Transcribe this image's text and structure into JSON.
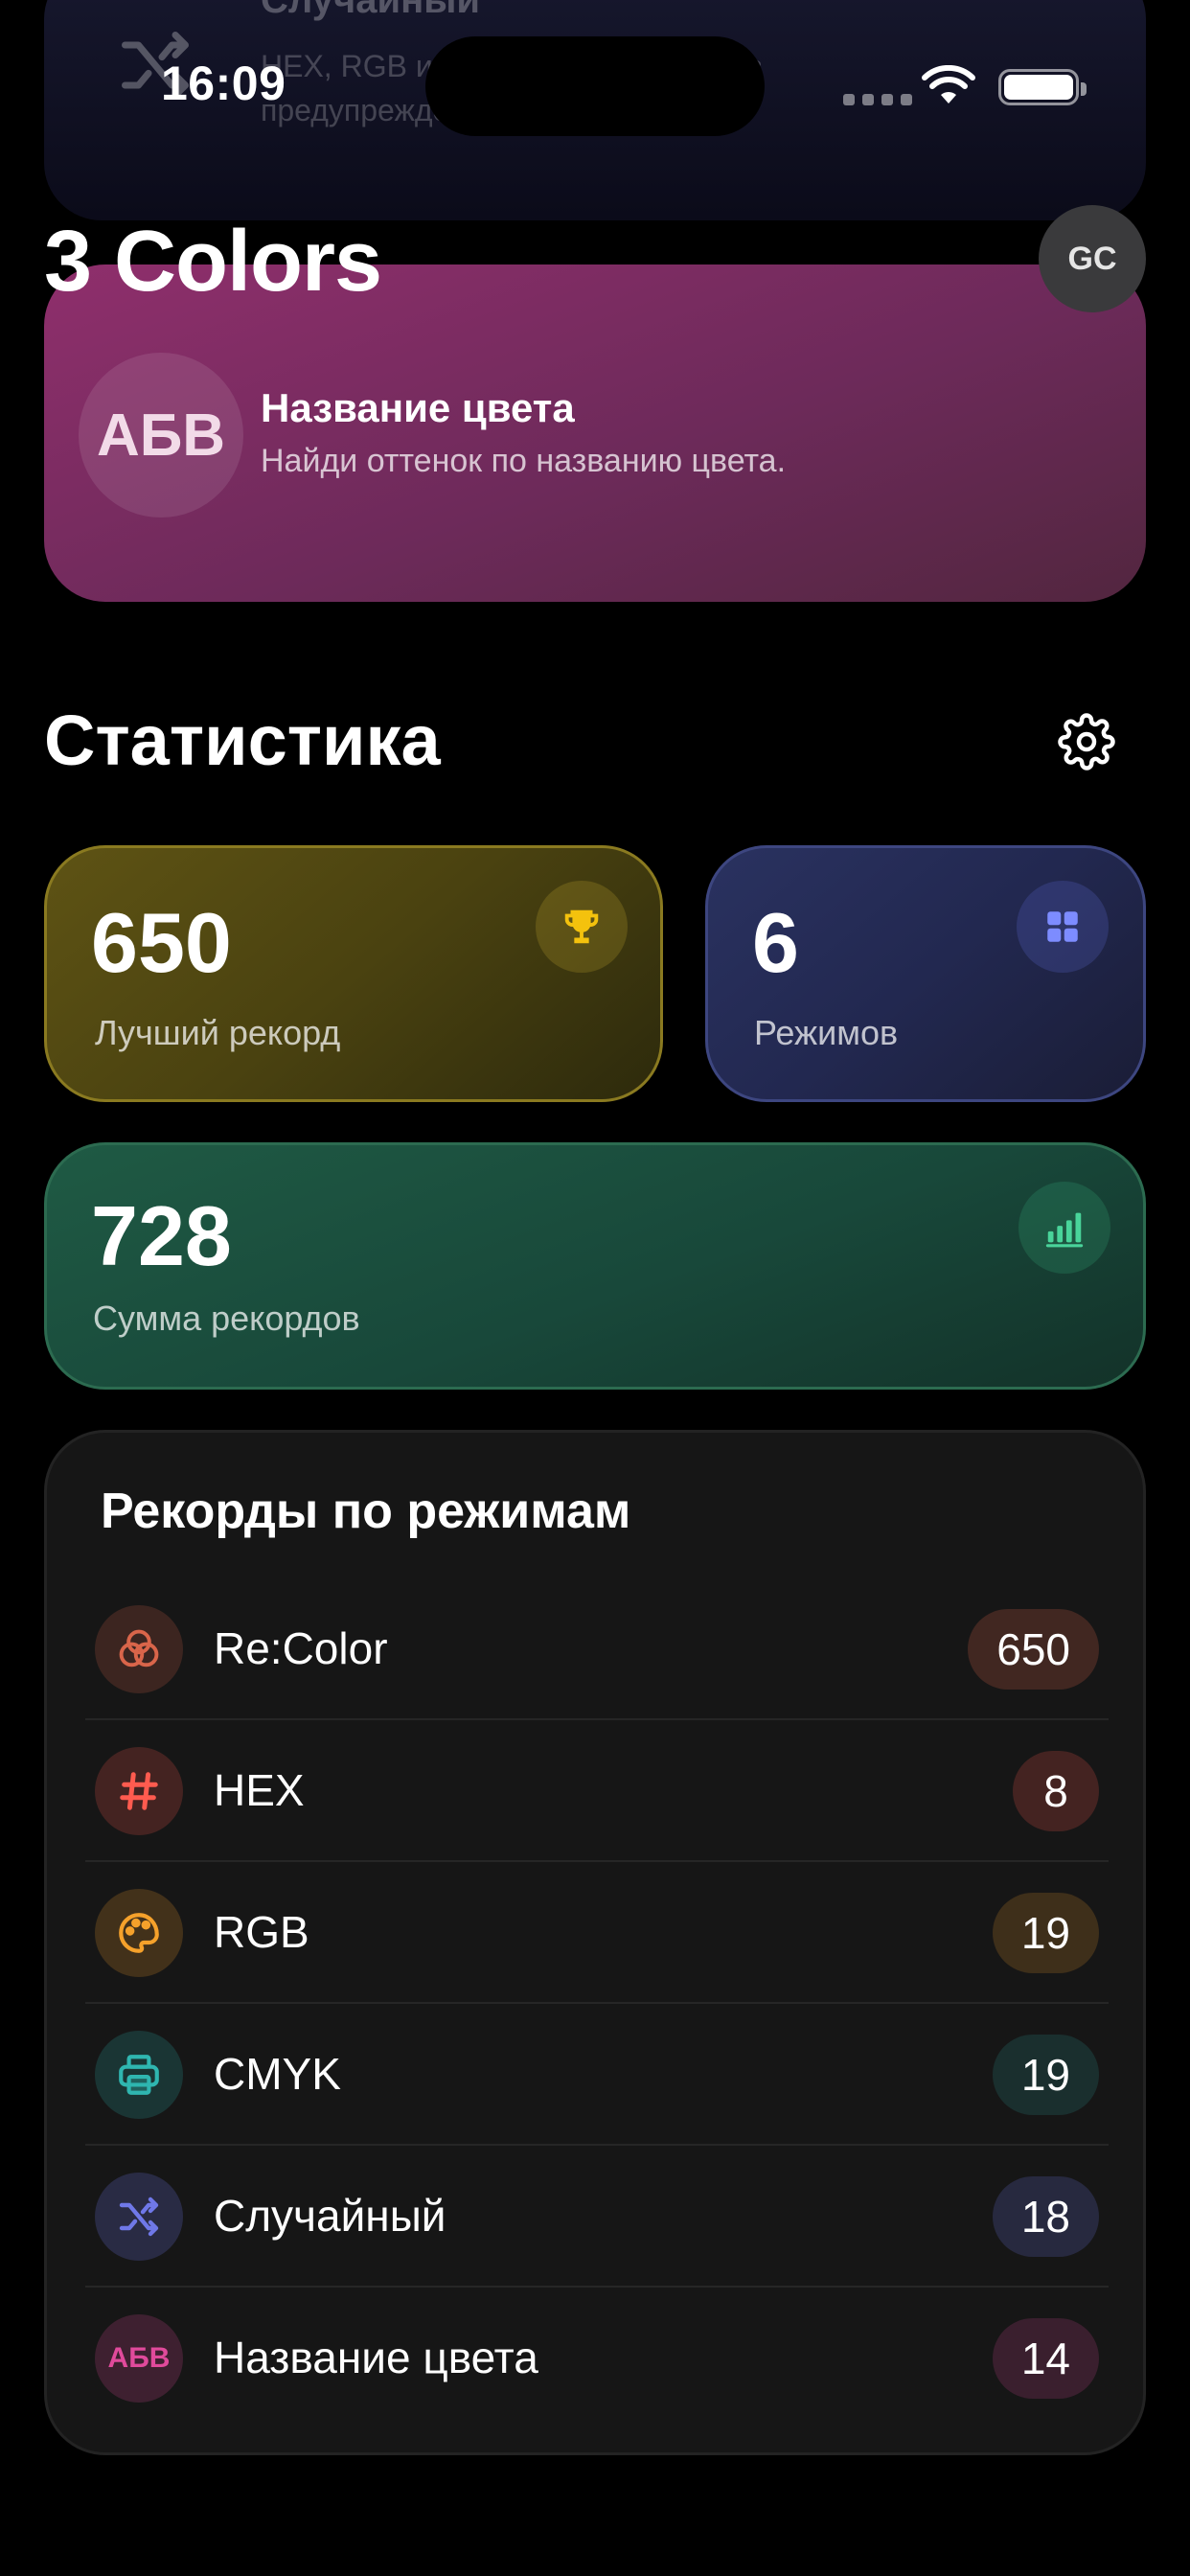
{
  "ghost": {
    "title": "Случайный",
    "subtitle": "HEX, RGB и CMYK чередуются без предупреждения."
  },
  "status": {
    "time": "16:09"
  },
  "app": {
    "title": "3 Colors",
    "avatar_initials": "GC"
  },
  "mode_card": {
    "badge": "АБВ",
    "title": "Название цвета",
    "subtitle": "Найди оттенок по названию цвета."
  },
  "stats": {
    "title": "Статистика",
    "best": {
      "value": "650",
      "label": "Лучший рекорд"
    },
    "modes": {
      "value": "6",
      "label": "Режимов"
    },
    "sum": {
      "value": "728",
      "label": "Сумма рекордов"
    }
  },
  "records": {
    "title": "Рекорды по режимам",
    "items": [
      {
        "name": "Re:Color",
        "score": "650",
        "icon": "overlapping-circles-icon",
        "color": "#d9654a"
      },
      {
        "name": "HEX",
        "score": "8",
        "icon": "hash-icon",
        "color": "#ff5b4f"
      },
      {
        "name": "RGB",
        "score": "19",
        "icon": "palette-icon",
        "color": "#f5a12b"
      },
      {
        "name": "CMYK",
        "score": "19",
        "icon": "printer-icon",
        "color": "#2fb6b0"
      },
      {
        "name": "Случайный",
        "score": "18",
        "icon": "shuffle-icon",
        "color": "#6f78e8"
      },
      {
        "name": "Название цвета",
        "score": "14",
        "icon": "abv-text-icon",
        "color": "#e04a9b"
      }
    ]
  }
}
